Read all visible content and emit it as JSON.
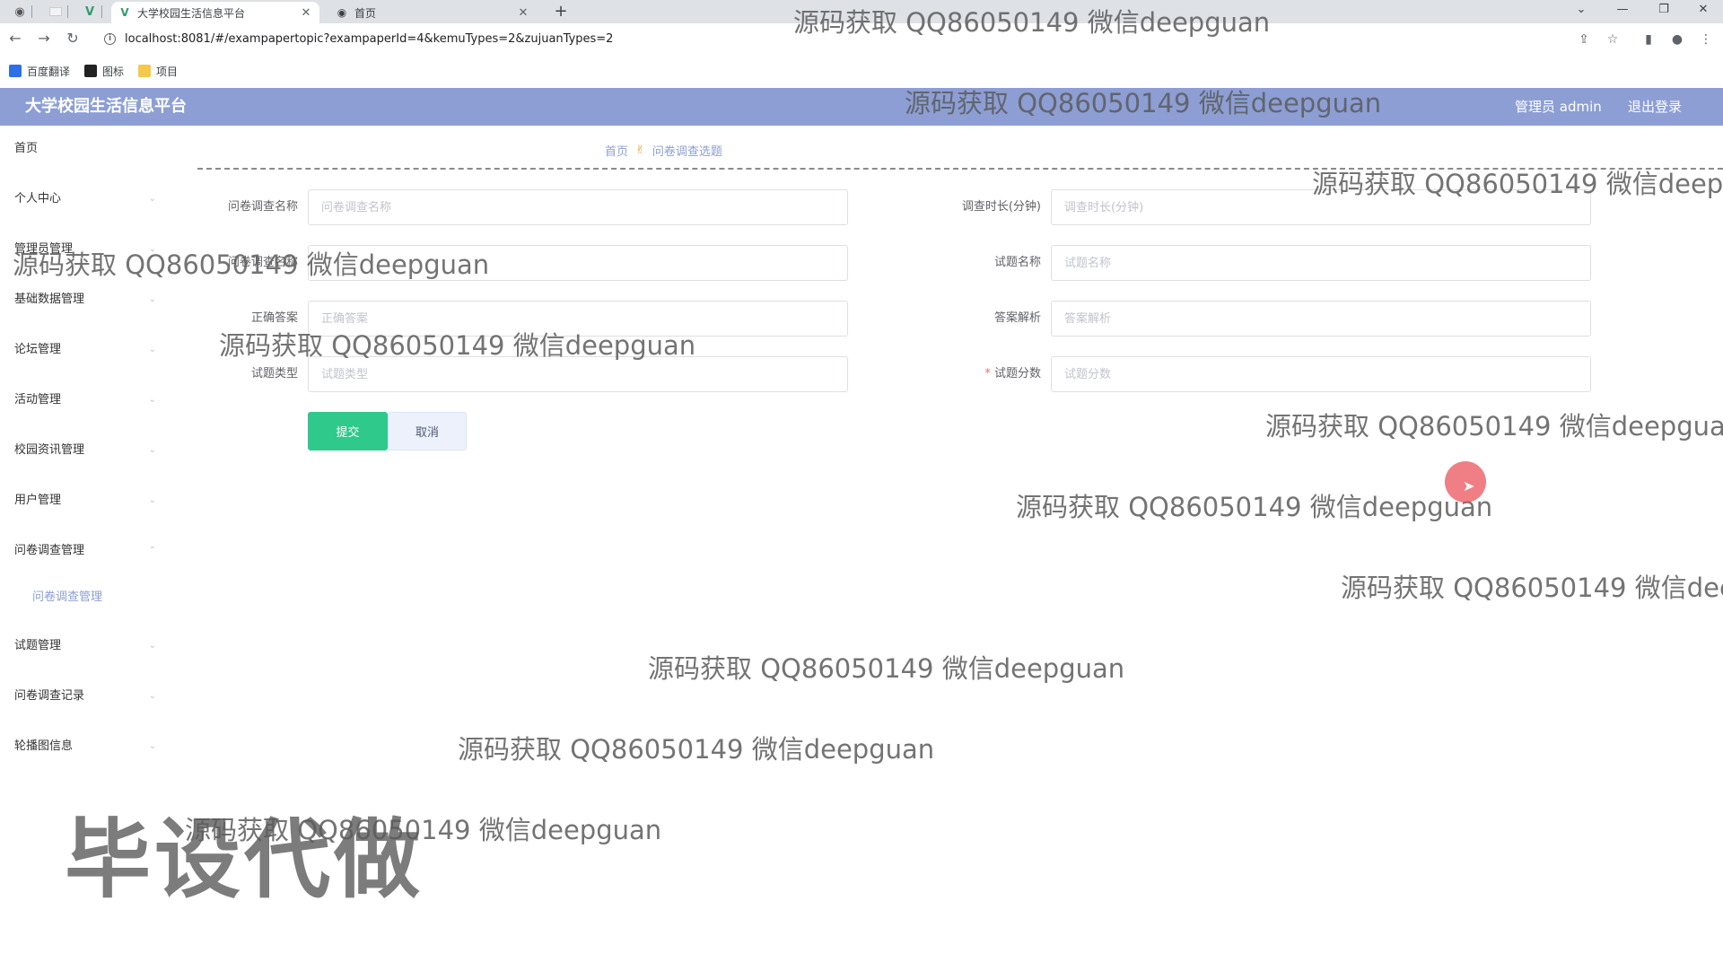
{
  "browser": {
    "tabs": [
      {
        "title": "大学校园生活信息平台",
        "active": true
      },
      {
        "title": "首页",
        "active": false
      }
    ],
    "url": "localhost:8081/#/exampapertopic?exampaperId=4&kemuTypes=2&zujuanTypes=2",
    "bookmarks": [
      {
        "label": "百度翻译"
      },
      {
        "label": "图标"
      },
      {
        "label": "项目"
      }
    ]
  },
  "app": {
    "title": "大学校园生活信息平台",
    "user_label": "管理员 admin",
    "logout_label": "退出登录"
  },
  "sidebar": {
    "items": [
      {
        "label": "首页",
        "has_arrow": false
      },
      {
        "label": "个人中心",
        "has_arrow": true
      },
      {
        "label": "管理员管理",
        "has_arrow": true
      },
      {
        "label": "基础数据管理",
        "has_arrow": true
      },
      {
        "label": "论坛管理",
        "has_arrow": true
      },
      {
        "label": "活动管理",
        "has_arrow": true
      },
      {
        "label": "校园资讯管理",
        "has_arrow": true
      },
      {
        "label": "用户管理",
        "has_arrow": true
      },
      {
        "label": "问卷调查管理",
        "has_arrow": true,
        "expanded": true
      },
      {
        "label": "问卷调查管理",
        "sub": true
      },
      {
        "label": "试题管理",
        "has_arrow": true
      },
      {
        "label": "问卷调查记录",
        "has_arrow": true
      },
      {
        "label": "轮播图信息",
        "has_arrow": true
      }
    ]
  },
  "breadcrumb": {
    "home": "首页",
    "current": "问卷调查选题"
  },
  "form": {
    "exampaper_name": {
      "label": "问卷调查名称",
      "placeholder": "问卷调查名称",
      "value": ""
    },
    "duration": {
      "label": "调查时长(分钟)",
      "placeholder": "调查时长(分钟)",
      "value": ""
    },
    "options": {
      "label": "问卷调查名称",
      "placeholder": "",
      "value": ""
    },
    "topic_name": {
      "label": "试题名称",
      "placeholder": "试题名称",
      "value": ""
    },
    "answer": {
      "label": "正确答案",
      "placeholder": "正确答案",
      "value": ""
    },
    "analysis": {
      "label": "答案解析",
      "placeholder": "答案解析",
      "value": ""
    },
    "topic_type": {
      "label": "试题类型",
      "placeholder": "试题类型",
      "value": ""
    },
    "score": {
      "label": "试题分数",
      "placeholder": "试题分数",
      "value": "",
      "required": true
    },
    "submit_label": "提交",
    "cancel_label": "取消"
  },
  "watermark": {
    "text": "源码获取 QQ86050149 微信deepguan",
    "stamp": "毕设代做"
  },
  "colors": {
    "header_bg": "#8c9ed4",
    "submit_bg": "#2fc98c",
    "accent": "#8c9ed4"
  }
}
